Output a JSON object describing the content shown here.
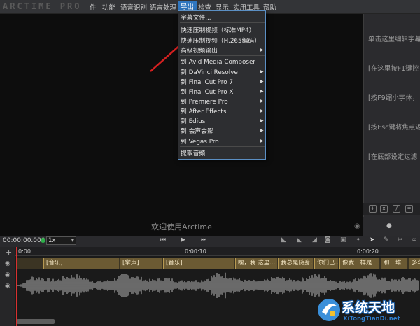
{
  "app": {
    "logo_text": "ARCTIME PRO"
  },
  "menubar": {
    "items": [
      "件",
      "功能",
      "语音识别",
      "语言处理",
      "导出",
      "检查",
      "显示",
      "实用工具",
      "帮助"
    ],
    "active": "导出"
  },
  "export_menu": {
    "items": [
      {
        "label": "字幕文件...",
        "submenu": false
      },
      {
        "label": "快速压制视频（标准MP4）",
        "submenu": false
      },
      {
        "label": "快速压制视频（H.265编码）",
        "submenu": false
      },
      {
        "label": "高级视频输出",
        "submenu": true
      },
      {
        "label": "到 Avid Media Composer",
        "submenu": false
      },
      {
        "label": "到 DaVinci Resolve",
        "submenu": true
      },
      {
        "label": "到 Final Cut Pro 7",
        "submenu": true
      },
      {
        "label": "到 Final Cut Pro X",
        "submenu": true
      },
      {
        "label": "到 Premiere Pro",
        "submenu": true
      },
      {
        "label": "到 After Effects",
        "submenu": true
      },
      {
        "label": "到 Edius",
        "submenu": true
      },
      {
        "label": "到 会声会影",
        "submenu": true
      },
      {
        "label": "到 Vegas Pro",
        "submenu": true
      },
      {
        "label": "提取音频",
        "submenu": false
      }
    ]
  },
  "video": {
    "welcome": "欢迎使用Arctime"
  },
  "help_panel": {
    "lines": [
      "单击这里编辑字幕",
      "[在这里按F1键控",
      "[按F9缩小字体，",
      "[按Esc键将焦点返",
      "[在底部设定过滤"
    ]
  },
  "transport": {
    "timecode": "00:00:00.000",
    "speed": "1x"
  },
  "timeline": {
    "ticks": [
      "0:00",
      "0:00:10",
      "0:00:20"
    ],
    "segments": [
      "[音乐]",
      "[掌声]",
      "[音乐]",
      "嘿，我 这里...",
      "我总是随身...",
      "你们已...",
      "像我一样是一...",
      "和一堆",
      "多年"
    ]
  },
  "watermark": {
    "title": "系统天地",
    "url": "XiTongTianDi.net"
  },
  "colors": {
    "accent": "#2f76bf",
    "annotation_arrow": "#d62020",
    "playhead": "#d83030",
    "segment": "#6b5a33"
  }
}
